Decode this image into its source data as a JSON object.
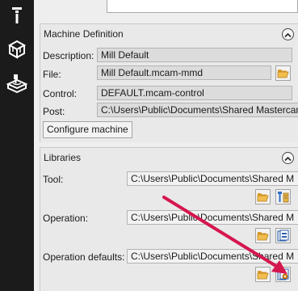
{
  "sidebar": {
    "items": [
      {
        "icon": "tool-icon"
      },
      {
        "icon": "stock-box-icon"
      },
      {
        "icon": "toolpath-icon"
      }
    ]
  },
  "machine_definition": {
    "title": "Machine Definition",
    "description_label": "Description:",
    "description_value": "Mill Default",
    "file_label": "File:",
    "file_value": "Mill Default.mcam-mmd",
    "control_label": "Control:",
    "control_value": "DEFAULT.mcam-control",
    "post_label": "Post:",
    "post_value": "C:\\Users\\Public\\Documents\\Shared Mastercam",
    "configure_button": "Configure machine"
  },
  "libraries": {
    "title": "Libraries",
    "tool_label": "Tool:",
    "tool_value": "C:\\Users\\Public\\Documents\\Shared M",
    "operation_label": "Operation:",
    "operation_value": "C:\\Users\\Public\\Documents\\Shared M",
    "operation_defaults_label": "Operation defaults:",
    "operation_defaults_value": "C:\\Users\\Public\\Documents\\Shared M"
  },
  "colors": {
    "annotation_arrow": "#d5174f",
    "rail_background": "#1b1b1b",
    "folder_icon": "#e6a93a"
  }
}
